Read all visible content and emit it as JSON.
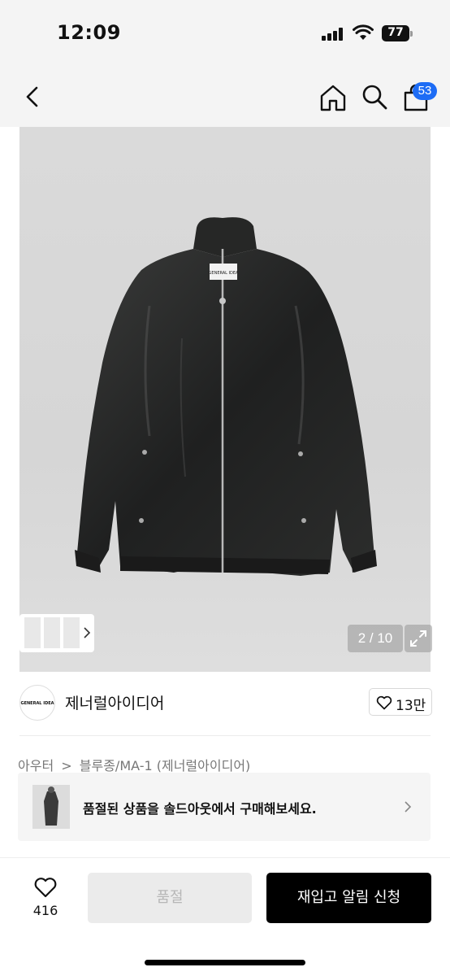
{
  "status_bar": {
    "time": "12:09",
    "battery": "77"
  },
  "nav": {
    "cart_count": "53"
  },
  "gallery": {
    "counter": "2 / 10",
    "label_text": "GENERAL IDEA"
  },
  "brand": {
    "logo_text": "GENERAL IDEA",
    "name": "제너럴아이디어",
    "likes": "13만"
  },
  "breadcrumb": {
    "items": [
      "아우터",
      ">",
      "블루종/MA-1 (제너럴아이디어)"
    ]
  },
  "soldout_banner": {
    "text": "품절된 상품을 솔드아웃에서 구매해보세요."
  },
  "bottom_bar": {
    "wish_count": "416",
    "soldout_label": "품절",
    "restock_label": "재입고 알림 신청"
  },
  "icons": {
    "back": "chevron-left-icon",
    "home": "home-icon",
    "search": "search-icon",
    "cart": "shopping-bag-icon",
    "expand": "expand-icon",
    "heart": "heart-icon"
  },
  "colors": {
    "badge": "#1d6cf5",
    "primary_button": "#000000",
    "disabled_button": "#ebebeb"
  }
}
